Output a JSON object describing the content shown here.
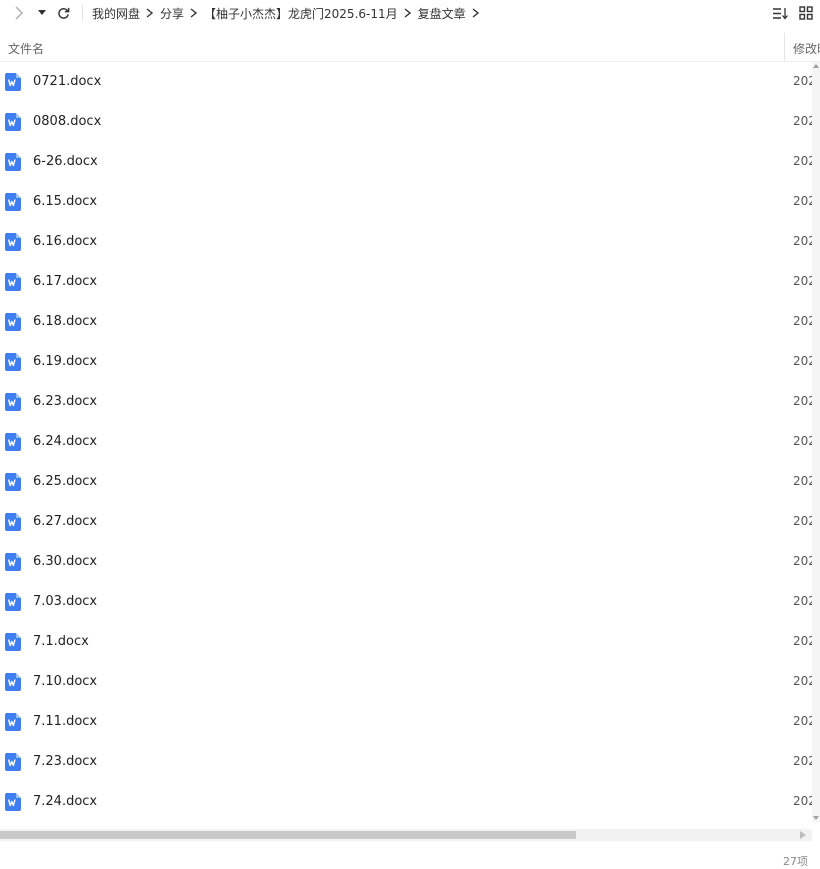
{
  "nav": {
    "forward_icon": "chevron-right-icon",
    "dropdown_icon": "caret-down-icon",
    "refresh_icon": "refresh-icon"
  },
  "breadcrumb": [
    "我的网盘",
    "分享",
    "【柚子小杰杰】龙虎门2025.6-11月",
    "复盘文章"
  ],
  "view": {
    "sort_icon": "sort-list-icon",
    "grid_icon": "grid-view-icon"
  },
  "columns": {
    "name": "文件名",
    "modified": "修改时"
  },
  "files": [
    {
      "name": "0721.docx",
      "date": "202"
    },
    {
      "name": "0808.docx",
      "date": "202"
    },
    {
      "name": "6-26.docx",
      "date": "202"
    },
    {
      "name": "6.15.docx",
      "date": "202"
    },
    {
      "name": "6.16.docx",
      "date": "202"
    },
    {
      "name": "6.17.docx",
      "date": "202"
    },
    {
      "name": "6.18.docx",
      "date": "202"
    },
    {
      "name": "6.19.docx",
      "date": "202"
    },
    {
      "name": "6.23.docx",
      "date": "202"
    },
    {
      "name": "6.24.docx",
      "date": "202"
    },
    {
      "name": "6.25.docx",
      "date": "202"
    },
    {
      "name": "6.27.docx",
      "date": "202"
    },
    {
      "name": "6.30.docx",
      "date": "202"
    },
    {
      "name": "7.03.docx",
      "date": "202"
    },
    {
      "name": "7.1.docx",
      "date": "202"
    },
    {
      "name": "7.10.docx",
      "date": "202"
    },
    {
      "name": "7.11.docx",
      "date": "202"
    },
    {
      "name": "7.23.docx",
      "date": "202"
    },
    {
      "name": "7.24.docx",
      "date": "202"
    }
  ],
  "file_icon": "word-doc-icon",
  "status": {
    "count": "27项"
  },
  "colors": {
    "word_icon": "#3d7ff0",
    "scroll_thumb": "#c8c8c8"
  }
}
